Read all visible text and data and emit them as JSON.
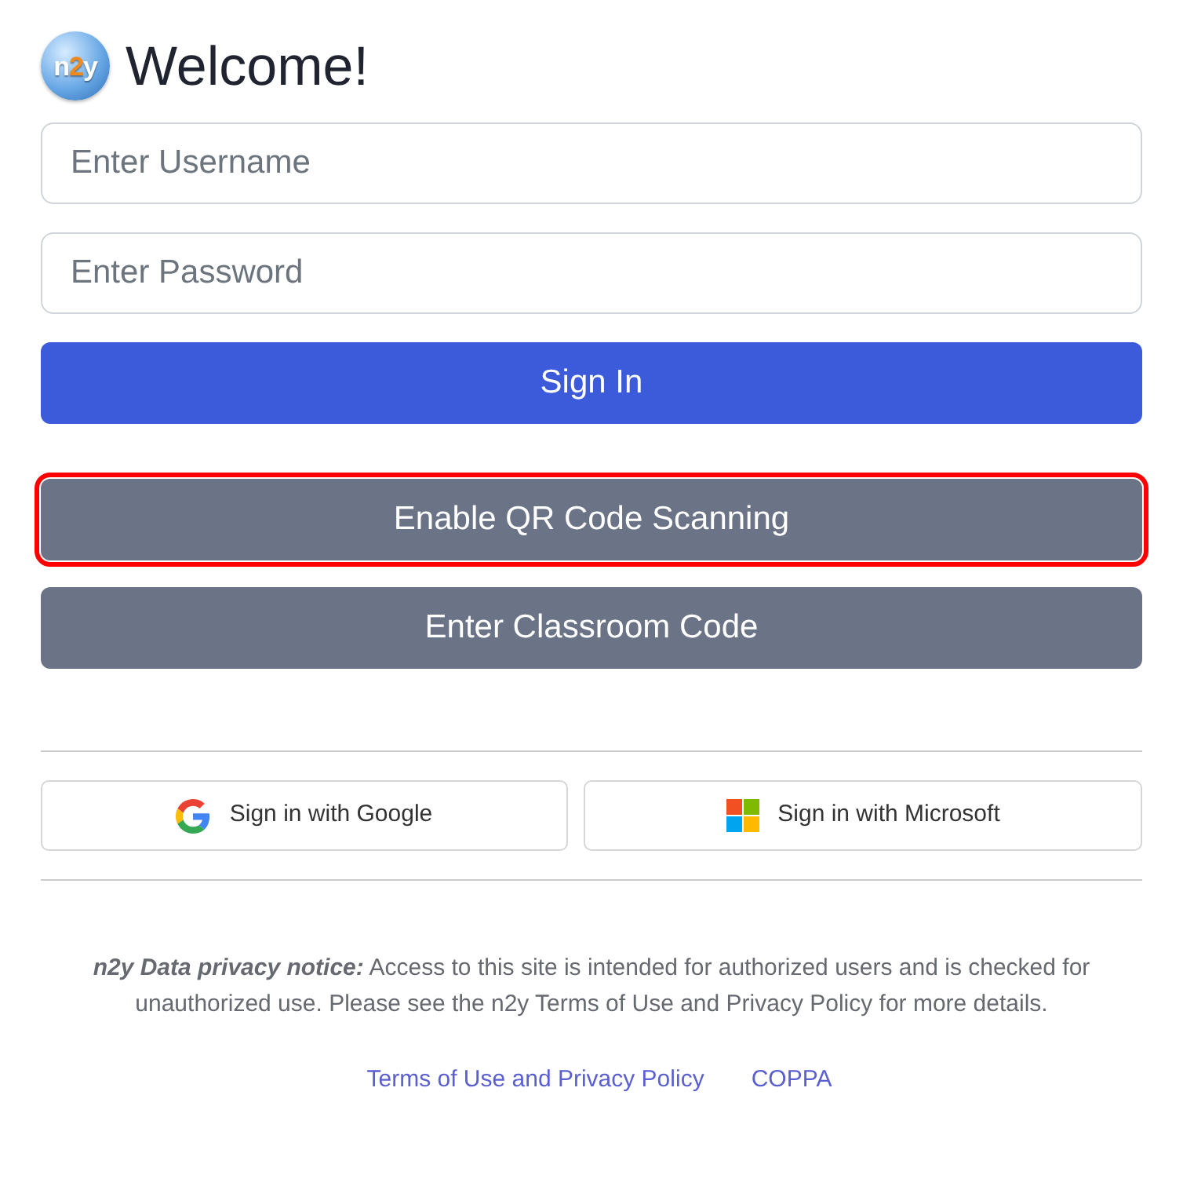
{
  "header": {
    "logo_text": "n2y",
    "title": "Welcome!"
  },
  "fields": [
    {
      "placeholder": "Enter Username"
    },
    {
      "placeholder": "Enter Password"
    }
  ],
  "buttons": [
    {
      "label": "Sign In",
      "kind": "primary",
      "highlighted": false
    },
    {
      "label": "Enable QR Code Scanning",
      "kind": "secondary",
      "highlighted": true
    },
    {
      "label": "Enter Classroom Code",
      "kind": "secondary",
      "highlighted": false
    }
  ],
  "social_buttons": [
    {
      "label": "Sign in with Google",
      "kind": "google"
    },
    {
      "label": "Sign in with Microsoft",
      "kind": "microsoft"
    }
  ],
  "privacy_notice": "**n2y Data privacy notice:** Access to this site is intended for authorized users and is checked for unauthorized use. Please see the n2y Terms of Use and Privacy Policy for more details.",
  "links": [
    "Terms of Use and Privacy Policy",
    "COPPA"
  ]
}
